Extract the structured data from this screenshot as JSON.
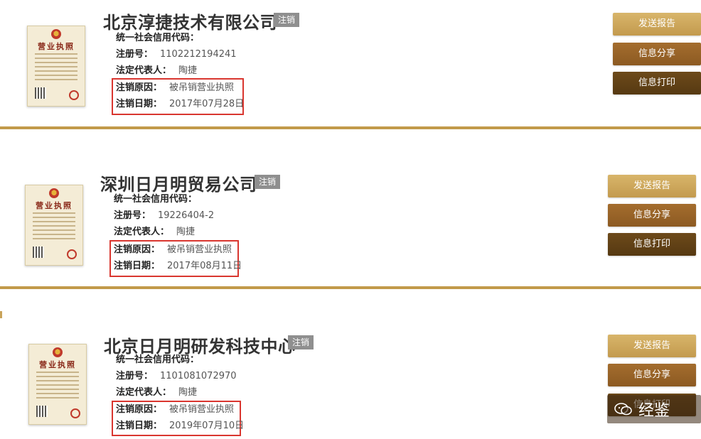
{
  "license_title": "营业执照",
  "badge_label": "注销",
  "labels": {
    "credit_code": "统一社会信用代码：",
    "reg_no": "注册号：",
    "legal_rep": "法定代表人：",
    "cancel_reason": "注销原因：",
    "cancel_date": "注销日期："
  },
  "buttons": {
    "send": "发送报告",
    "share": "信息分享",
    "print": "信息打印"
  },
  "companies": [
    {
      "name": "北京淳捷技术有限公司",
      "credit_code": "",
      "reg_no": "1102212194241",
      "legal_rep": "陶捷",
      "cancel_reason": "被吊销营业执照",
      "cancel_date": "2017年07月28日"
    },
    {
      "name": "深圳日月明贸易公司",
      "credit_code": "",
      "reg_no": "19226404-2",
      "legal_rep": "陶捷",
      "cancel_reason": "被吊销营业执照",
      "cancel_date": "2017年08月11日"
    },
    {
      "name": "北京日月明研发科技中心",
      "credit_code": "",
      "reg_no": "1101081072970",
      "legal_rep": "陶捷",
      "cancel_reason": "被吊销营业执照",
      "cancel_date": "2019年07月10日"
    }
  ],
  "watermark": "经鉴"
}
